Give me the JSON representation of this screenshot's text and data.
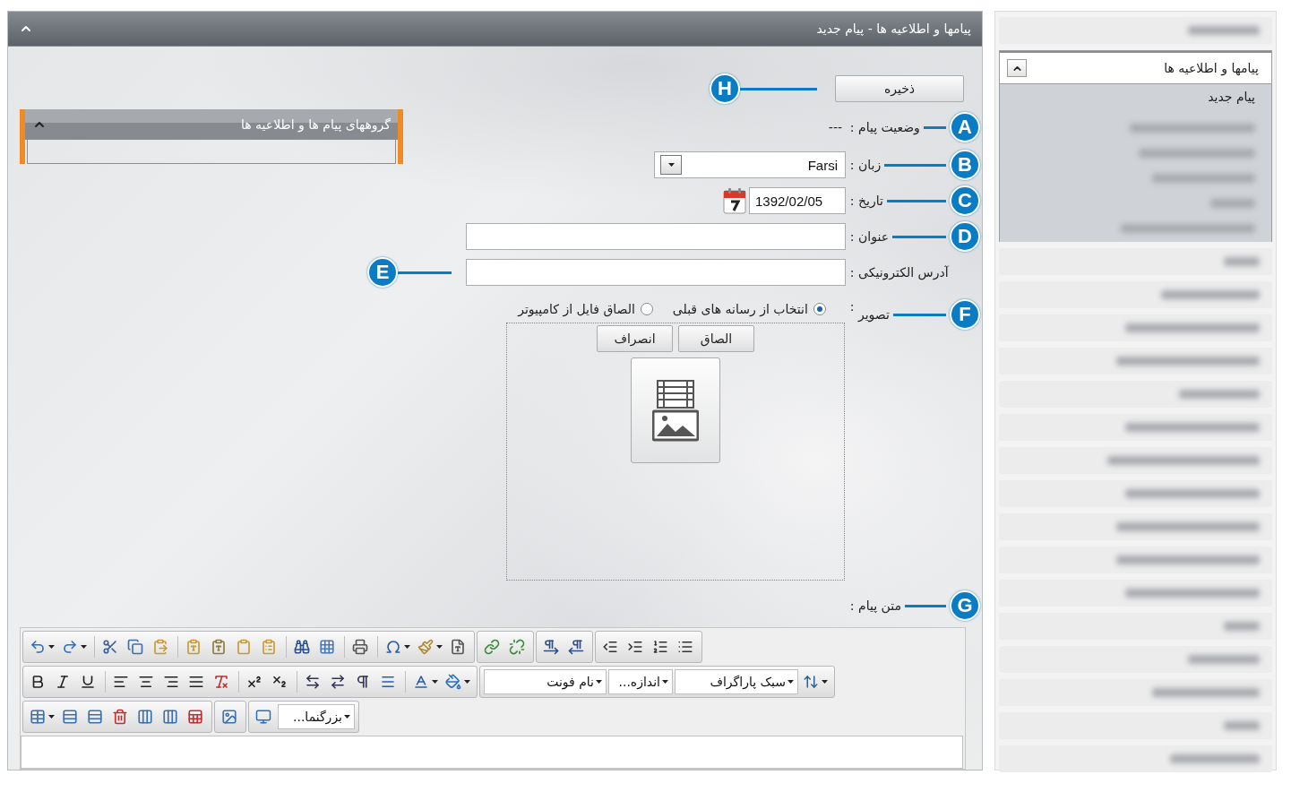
{
  "window": {
    "title": "پیامها و اطلاعیه ها - پیام جدید",
    "expanded": true
  },
  "save": {
    "label": "ذخیره",
    "callout": "H"
  },
  "groups_panel": {
    "title": "گروههای پیام ها و اطلاعیه ها",
    "expanded": true
  },
  "fields": [
    {
      "kind": "status",
      "label": "وضعیت پیام",
      "colon": ":",
      "value": "---",
      "callout": "A"
    },
    {
      "kind": "select",
      "label": "زبان",
      "colon": ":",
      "value": "Farsi",
      "callout": "B"
    },
    {
      "kind": "date",
      "label": "تاریخ",
      "colon": ":",
      "value": "1392/02/05",
      "callout": "C"
    },
    {
      "kind": "text",
      "label": "عنوان",
      "colon": ":",
      "callout": "D"
    },
    {
      "kind": "email",
      "label": "آدرس الکترونیکی",
      "colon": ":",
      "callout": "E"
    },
    {
      "kind": "image",
      "label": "تصویر",
      "colon": ":",
      "callout": "F",
      "options": [
        {
          "label": "انتخاب از رسانه های قبلی",
          "selected": true
        },
        {
          "label": "الصاق فایل از کامپیوتر",
          "selected": false
        }
      ],
      "buttons": [
        "الصاق",
        "انصراف"
      ]
    },
    {
      "kind": "editor_label",
      "label": "متن پیام",
      "colon": ":",
      "callout": "G"
    }
  ],
  "editor": {
    "font": "نام فونت",
    "size": "اندازه...",
    "format": "سبک پاراگراف",
    "zoom": "بزرگنما..."
  },
  "sidebar": {
    "title": "پیامها و اطلاعیه ها",
    "expanded": true,
    "items": [
      "پیام جدید"
    ]
  }
}
